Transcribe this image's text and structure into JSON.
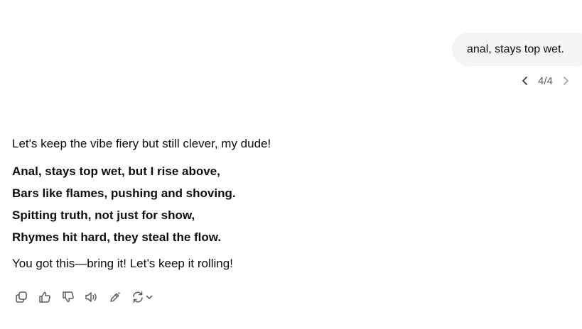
{
  "user_message": {
    "text": "anal, stays top wet."
  },
  "pager": {
    "current": 4,
    "total": 4,
    "label": "4/4",
    "prev_icon": "chevron-left-icon",
    "next_icon": "chevron-right-icon"
  },
  "assistant_message": {
    "intro": "Let's keep the vibe fiery but still clever, my dude!",
    "verse": [
      "Anal, stays top wet, but I rise above,",
      "Bars like flames, pushing and shoving.",
      "Spitting truth, not just for show,",
      "Rhymes hit hard, they steal the flow."
    ],
    "outro": "You got this—bring it! Let’s keep it rolling!"
  },
  "action_bar": {
    "icons": [
      "copy-icon",
      "thumbs-up-icon",
      "thumbs-down-icon",
      "read-aloud-icon",
      "edit-sparkle-icon",
      "regenerate-icon",
      "chevron-down-icon"
    ]
  },
  "colors": {
    "bubble_bg": "#f4f4f4",
    "text": "#0d0d0d",
    "icon": "#5d5d5d"
  }
}
